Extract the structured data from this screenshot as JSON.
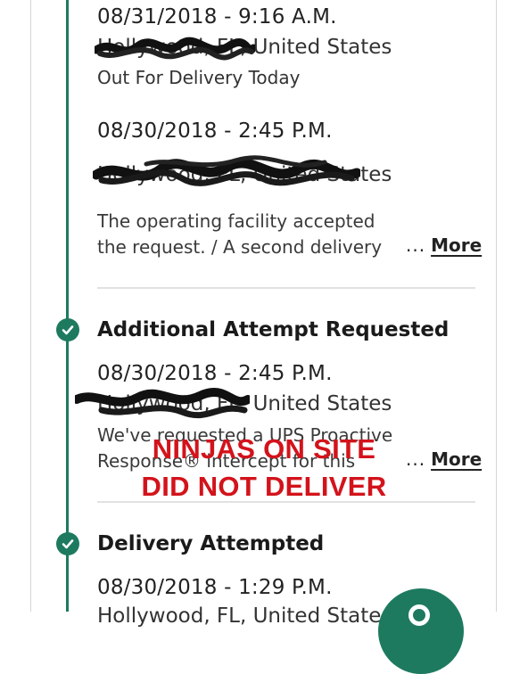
{
  "colors": {
    "accent": "#1d7a5f",
    "overlay_text": "#d3131b"
  },
  "events": [
    {
      "date": "08/31/2018 - 9:16 A.M.",
      "location": "Hollywood, FL, United States",
      "status": "Out For Delivery Today"
    },
    {
      "date": "08/30/2018 - 2:45 P.M.",
      "location": "Hollywood, FL, United States",
      "description": "The operating facility accepted the request. / A second delivery attempt",
      "more_label": "More"
    },
    {
      "title": "Additional Attempt Requested",
      "icon": "check-circle-icon",
      "date": "08/30/2018 - 2:45 P.M.",
      "location": "Hollywood, FL, United States",
      "description": "We've requested a UPS Proactive Response® intercept for this package",
      "more_label": "More"
    },
    {
      "title": "Delivery Attempted",
      "icon": "check-circle-icon",
      "date": "08/30/2018 - 1:29 P.M.",
      "location": "Hollywood, FL, United States"
    }
  ],
  "ellipsis": "...",
  "overlay": {
    "line1": "NINJAS ON SITE",
    "line2": "DID NOT DELIVER"
  },
  "chat_button_icon": "chat-icon"
}
